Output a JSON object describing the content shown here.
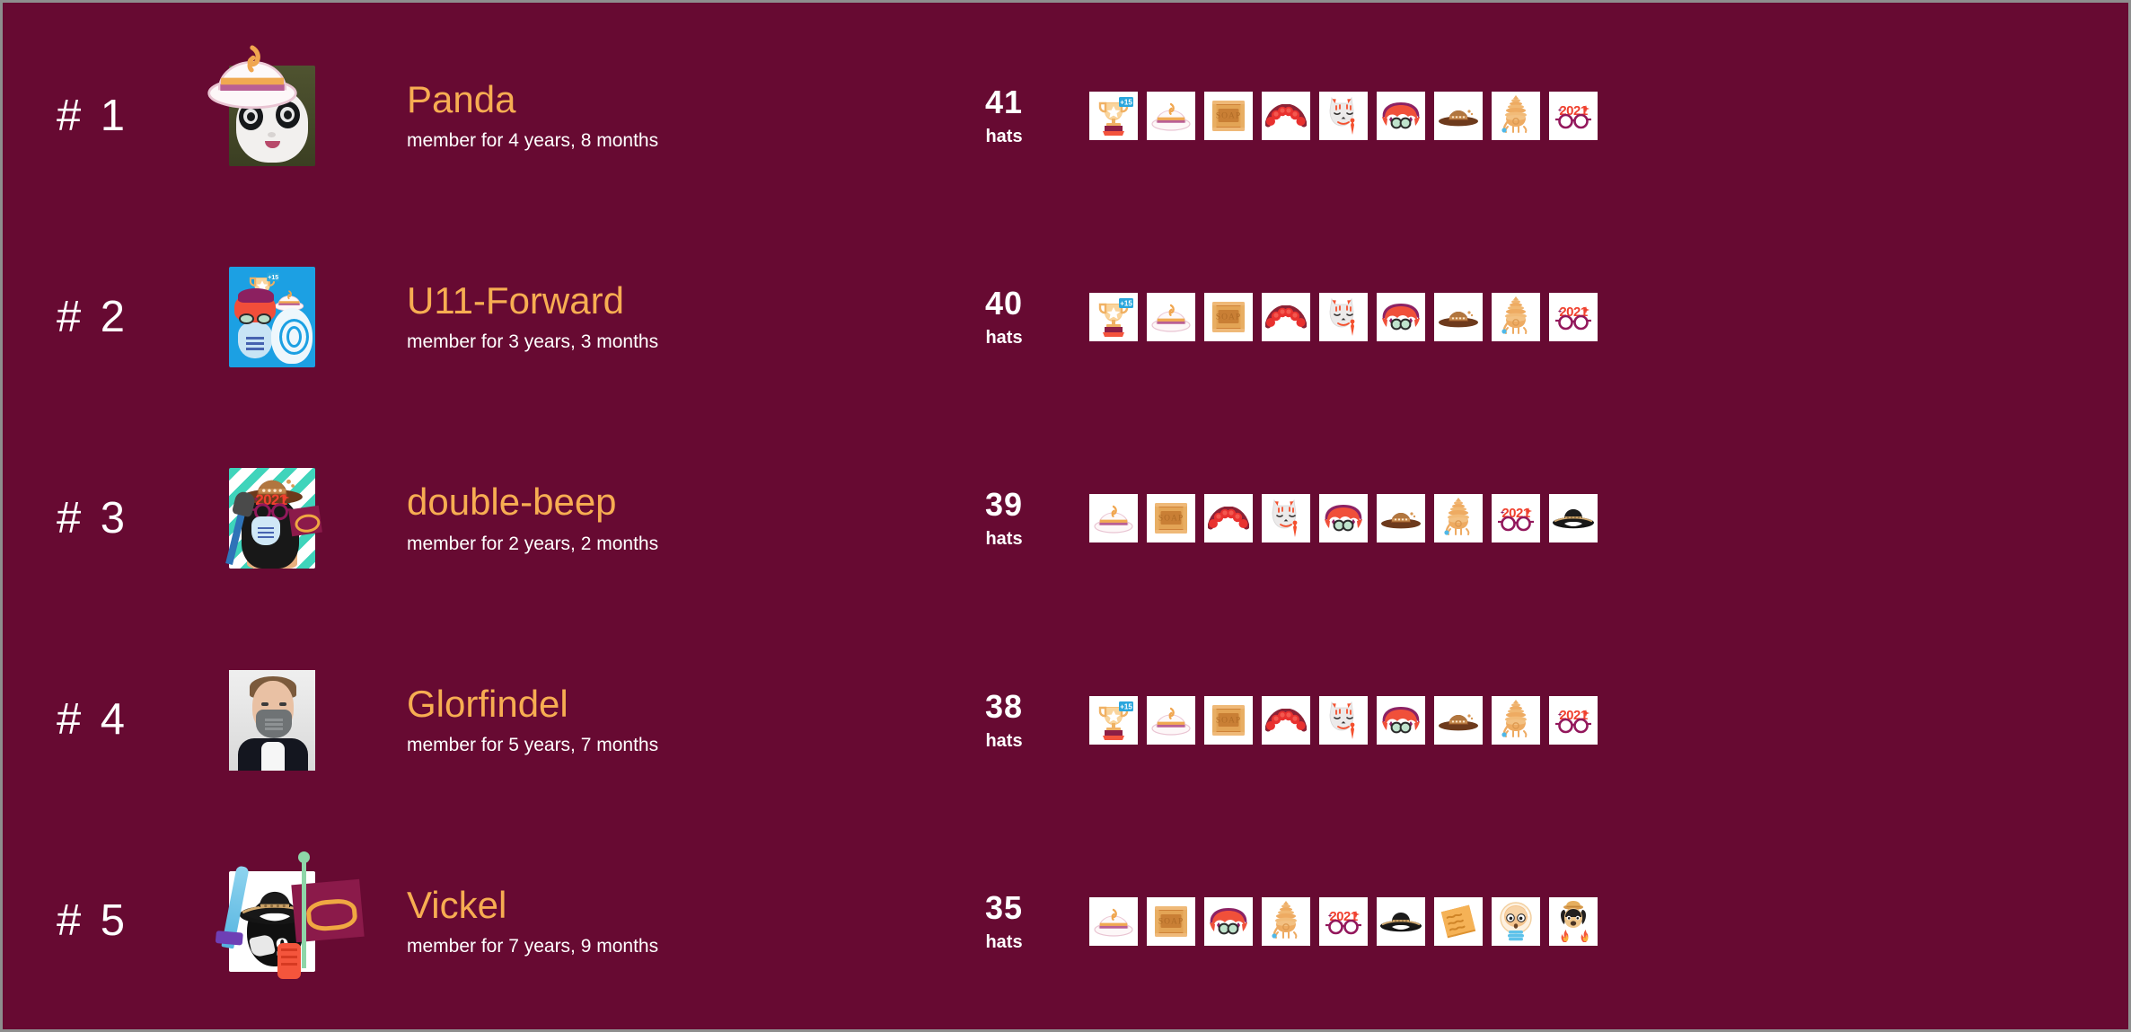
{
  "page": {
    "type": "hat-leaderboard",
    "background_color": "#670a32",
    "accent_name_color": "#f7ad52",
    "text_color": "#ffffff",
    "hat_tile_color": "#ffffff",
    "border_color": "#8e8e8e"
  },
  "rows": [
    {
      "rank": "# 1",
      "username": "Panda",
      "membership": "member for 4 years, 8 months",
      "count": "41",
      "count_label": "hats",
      "avatar_style": "panda-with-white-hat",
      "hats": [
        "trophy-plus15-icon",
        "white-pink-bowler-hat-icon",
        "soap-crate-icon",
        "red-flower-crown-icon",
        "kitsune-fox-mask-icon",
        "red-purple-hair-goggles-icon",
        "brown-sun-hat-icon",
        "orange-pagoda-hat-icon",
        "new-year-2021-glasses-icon"
      ]
    },
    {
      "rank": "# 2",
      "username": "U11-Forward",
      "membership": "member for 3 years, 3 months",
      "count": "40",
      "count_label": "hats",
      "avatar_style": "blue-bg-masked-figure",
      "hats": [
        "trophy-plus15-icon",
        "white-pink-bowler-hat-icon",
        "soap-crate-icon",
        "red-flower-crown-icon",
        "kitsune-fox-mask-icon",
        "red-purple-hair-goggles-icon",
        "brown-sun-hat-icon",
        "orange-pagoda-hat-icon",
        "new-year-2021-glasses-icon"
      ]
    },
    {
      "rank": "# 3",
      "username": "double-beep",
      "membership": "member for 2 years, 2 months",
      "count": "39",
      "count_label": "hats",
      "avatar_style": "bird-sombrero-2021-glasses",
      "hats": [
        "white-pink-bowler-hat-icon",
        "soap-crate-icon",
        "red-flower-crown-icon",
        "kitsune-fox-mask-icon",
        "red-purple-hair-goggles-icon",
        "brown-sun-hat-icon",
        "orange-pagoda-hat-icon",
        "new-year-2021-glasses-icon",
        "black-sombrero-icon"
      ]
    },
    {
      "rank": "# 4",
      "username": "Glorfindel",
      "membership": "member for 5 years, 7 months",
      "count": "38",
      "count_label": "hats",
      "avatar_style": "photo-man-grey-mask",
      "hats": [
        "trophy-plus15-icon",
        "white-pink-bowler-hat-icon",
        "soap-crate-icon",
        "red-flower-crown-icon",
        "kitsune-fox-mask-icon",
        "red-purple-hair-goggles-icon",
        "brown-sun-hat-icon",
        "orange-pagoda-hat-icon",
        "new-year-2021-glasses-icon"
      ]
    },
    {
      "rank": "# 5",
      "username": "Vickel",
      "membership": "member for 7 years, 9 months",
      "count": "35",
      "count_label": "hats",
      "avatar_style": "sword-sombrero-flag",
      "hats": [
        "white-pink-bowler-hat-icon",
        "soap-crate-icon",
        "red-purple-hair-goggles-icon",
        "orange-pagoda-hat-icon",
        "new-year-2021-glasses-icon",
        "black-sombrero-icon",
        "orange-sticky-note-icon",
        "bubble-helmet-head-icon",
        "dog-with-fire-icon"
      ]
    }
  ],
  "icon_text": {
    "trophy_badge": "+15",
    "soap_label": "SOAP",
    "year_glasses": "2021"
  }
}
